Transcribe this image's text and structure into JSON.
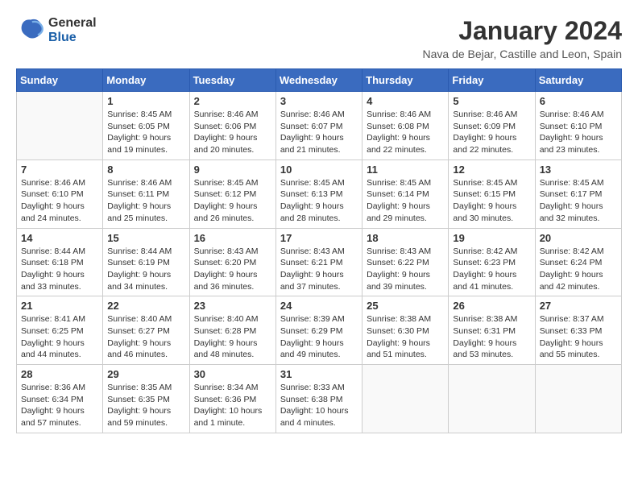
{
  "header": {
    "logo_line1": "General",
    "logo_line2": "Blue",
    "month_year": "January 2024",
    "location": "Nava de Bejar, Castille and Leon, Spain"
  },
  "columns": [
    "Sunday",
    "Monday",
    "Tuesday",
    "Wednesday",
    "Thursday",
    "Friday",
    "Saturday"
  ],
  "weeks": [
    [
      {
        "day": "",
        "info": ""
      },
      {
        "day": "1",
        "info": "Sunrise: 8:45 AM\nSunset: 6:05 PM\nDaylight: 9 hours\nand 19 minutes."
      },
      {
        "day": "2",
        "info": "Sunrise: 8:46 AM\nSunset: 6:06 PM\nDaylight: 9 hours\nand 20 minutes."
      },
      {
        "day": "3",
        "info": "Sunrise: 8:46 AM\nSunset: 6:07 PM\nDaylight: 9 hours\nand 21 minutes."
      },
      {
        "day": "4",
        "info": "Sunrise: 8:46 AM\nSunset: 6:08 PM\nDaylight: 9 hours\nand 22 minutes."
      },
      {
        "day": "5",
        "info": "Sunrise: 8:46 AM\nSunset: 6:09 PM\nDaylight: 9 hours\nand 22 minutes."
      },
      {
        "day": "6",
        "info": "Sunrise: 8:46 AM\nSunset: 6:10 PM\nDaylight: 9 hours\nand 23 minutes."
      }
    ],
    [
      {
        "day": "7",
        "info": "Sunrise: 8:46 AM\nSunset: 6:10 PM\nDaylight: 9 hours\nand 24 minutes."
      },
      {
        "day": "8",
        "info": "Sunrise: 8:46 AM\nSunset: 6:11 PM\nDaylight: 9 hours\nand 25 minutes."
      },
      {
        "day": "9",
        "info": "Sunrise: 8:45 AM\nSunset: 6:12 PM\nDaylight: 9 hours\nand 26 minutes."
      },
      {
        "day": "10",
        "info": "Sunrise: 8:45 AM\nSunset: 6:13 PM\nDaylight: 9 hours\nand 28 minutes."
      },
      {
        "day": "11",
        "info": "Sunrise: 8:45 AM\nSunset: 6:14 PM\nDaylight: 9 hours\nand 29 minutes."
      },
      {
        "day": "12",
        "info": "Sunrise: 8:45 AM\nSunset: 6:15 PM\nDaylight: 9 hours\nand 30 minutes."
      },
      {
        "day": "13",
        "info": "Sunrise: 8:45 AM\nSunset: 6:17 PM\nDaylight: 9 hours\nand 32 minutes."
      }
    ],
    [
      {
        "day": "14",
        "info": "Sunrise: 8:44 AM\nSunset: 6:18 PM\nDaylight: 9 hours\nand 33 minutes."
      },
      {
        "day": "15",
        "info": "Sunrise: 8:44 AM\nSunset: 6:19 PM\nDaylight: 9 hours\nand 34 minutes."
      },
      {
        "day": "16",
        "info": "Sunrise: 8:43 AM\nSunset: 6:20 PM\nDaylight: 9 hours\nand 36 minutes."
      },
      {
        "day": "17",
        "info": "Sunrise: 8:43 AM\nSunset: 6:21 PM\nDaylight: 9 hours\nand 37 minutes."
      },
      {
        "day": "18",
        "info": "Sunrise: 8:43 AM\nSunset: 6:22 PM\nDaylight: 9 hours\nand 39 minutes."
      },
      {
        "day": "19",
        "info": "Sunrise: 8:42 AM\nSunset: 6:23 PM\nDaylight: 9 hours\nand 41 minutes."
      },
      {
        "day": "20",
        "info": "Sunrise: 8:42 AM\nSunset: 6:24 PM\nDaylight: 9 hours\nand 42 minutes."
      }
    ],
    [
      {
        "day": "21",
        "info": "Sunrise: 8:41 AM\nSunset: 6:25 PM\nDaylight: 9 hours\nand 44 minutes."
      },
      {
        "day": "22",
        "info": "Sunrise: 8:40 AM\nSunset: 6:27 PM\nDaylight: 9 hours\nand 46 minutes."
      },
      {
        "day": "23",
        "info": "Sunrise: 8:40 AM\nSunset: 6:28 PM\nDaylight: 9 hours\nand 48 minutes."
      },
      {
        "day": "24",
        "info": "Sunrise: 8:39 AM\nSunset: 6:29 PM\nDaylight: 9 hours\nand 49 minutes."
      },
      {
        "day": "25",
        "info": "Sunrise: 8:38 AM\nSunset: 6:30 PM\nDaylight: 9 hours\nand 51 minutes."
      },
      {
        "day": "26",
        "info": "Sunrise: 8:38 AM\nSunset: 6:31 PM\nDaylight: 9 hours\nand 53 minutes."
      },
      {
        "day": "27",
        "info": "Sunrise: 8:37 AM\nSunset: 6:33 PM\nDaylight: 9 hours\nand 55 minutes."
      }
    ],
    [
      {
        "day": "28",
        "info": "Sunrise: 8:36 AM\nSunset: 6:34 PM\nDaylight: 9 hours\nand 57 minutes."
      },
      {
        "day": "29",
        "info": "Sunrise: 8:35 AM\nSunset: 6:35 PM\nDaylight: 9 hours\nand 59 minutes."
      },
      {
        "day": "30",
        "info": "Sunrise: 8:34 AM\nSunset: 6:36 PM\nDaylight: 10 hours\nand 1 minute."
      },
      {
        "day": "31",
        "info": "Sunrise: 8:33 AM\nSunset: 6:38 PM\nDaylight: 10 hours\nand 4 minutes."
      },
      {
        "day": "",
        "info": ""
      },
      {
        "day": "",
        "info": ""
      },
      {
        "day": "",
        "info": ""
      }
    ]
  ]
}
